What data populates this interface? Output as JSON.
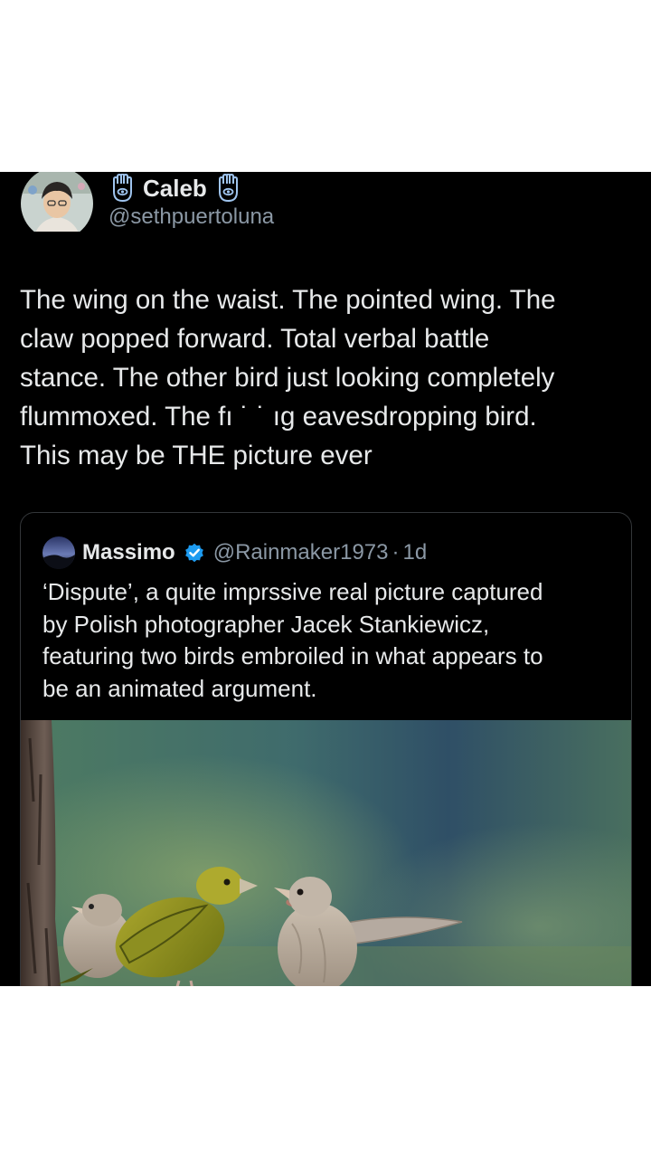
{
  "tweet": {
    "author": {
      "display_name": "Caleb",
      "handle": "@sethpuertoluna",
      "name_decoration_icon": "hamsa-icon"
    },
    "text": "The wing on the waist. The pointed wing. The\nclaw popped forward. Total verbal battle\nstance. The other bird just looking completely\nflummoxed. The fı   ˙ ˙  ıg eavesdropping bird.\nThis may be THE picture ever"
  },
  "quote": {
    "author": {
      "display_name": "Massimo",
      "handle": "@Rainmaker1973",
      "separator": "·",
      "time": "1d",
      "verified_icon": "verified-badge-icon"
    },
    "text": "‘Dispute’, a quite imprssive real picture captured\nby Polish photographer Jacek Stankiewicz,\nfeaturing two birds embroiled in what appears to\nbe an animated argument.",
    "photo": "three finches on a branch beside a tree trunk"
  },
  "colors": {
    "background": "#000000",
    "text_primary": "#e7e9ea",
    "text_secondary": "#8b98a5",
    "card_border": "#333639",
    "verified_blue": "#1d9bf0",
    "hamsa_blue": "#9fc4ee"
  }
}
